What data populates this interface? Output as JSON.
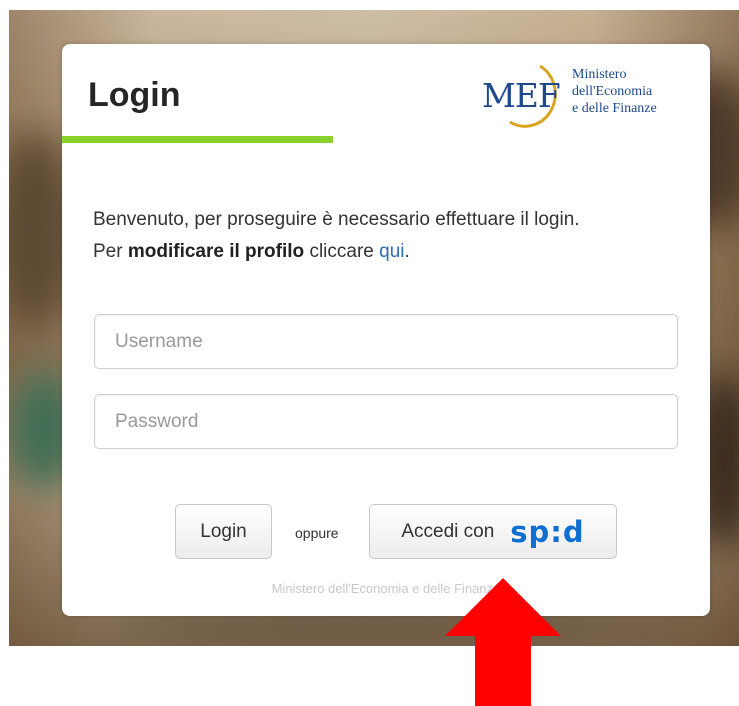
{
  "login_card": {
    "title": "Login",
    "logo": {
      "mef_text": "MEF",
      "ministry_line1": "Ministero",
      "ministry_line2": "dell'Economia",
      "ministry_line3": "e delle Finanze"
    },
    "welcome_line1": "Benvenuto, per proseguire è necessario effettuare il login.",
    "welcome_prefix": "Per ",
    "welcome_bold": "modificare il profilo",
    "welcome_mid": " cliccare ",
    "welcome_link": "qui",
    "welcome_end": ".",
    "username_placeholder": "Username",
    "password_placeholder": "Password",
    "login_button": "Login",
    "oppure": "oppure",
    "spid_button_prefix": "Accedi con",
    "spid_logo_text": "sp:d",
    "footer": "Ministero dell'Economia e delle Finanze"
  },
  "colors": {
    "accent_green": "#8ad12e",
    "link_blue": "#2d6cb6",
    "spid_blue": "#0f6fd1",
    "arrow_red": "#ff0000"
  },
  "icons": {
    "annotation": "red-up-arrow"
  }
}
